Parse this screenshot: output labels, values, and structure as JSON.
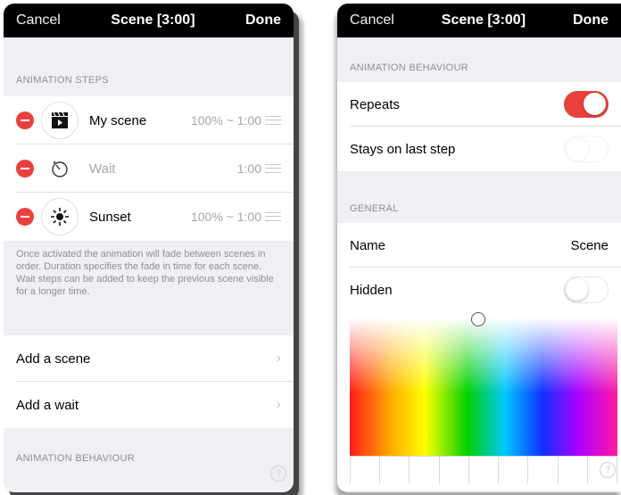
{
  "left": {
    "nav": {
      "cancel": "Cancel",
      "title": "Scene [3:00]",
      "done": "Done"
    },
    "steps_header": "ANIMATION STEPS",
    "steps": [
      {
        "icon": "scene-icon",
        "label": "My scene",
        "value": "100% ~ 1:00"
      },
      {
        "icon": "timer-icon",
        "label": "Wait",
        "value": "1:00"
      },
      {
        "icon": "sun-icon",
        "label": "Sunset",
        "value": "100% ~ 1:00"
      }
    ],
    "footer_note": "Once activated the animation will fade between scenes in order. Duration specifies the fade in time for each scene. Wait steps can be added to keep the previous scene visible for a longer time.",
    "actions": [
      {
        "label": "Add a scene"
      },
      {
        "label": "Add a wait"
      }
    ],
    "behaviour_header": "ANIMATION BEHAVIOUR"
  },
  "right": {
    "nav": {
      "cancel": "Cancel",
      "title": "Scene [3:00]",
      "done": "Done"
    },
    "behaviour_header": "ANIMATION BEHAVIOUR",
    "repeats_label": "Repeats",
    "repeats_on": true,
    "stays_label": "Stays on last step",
    "stays_on": false,
    "general_header": "GENERAL",
    "name_label": "Name",
    "name_value": "Scene",
    "hidden_label": "Hidden",
    "hidden_on": false
  },
  "colors": {
    "accent": "#e8413d",
    "nav_bg": "#000000",
    "group_bg": "#efeff4"
  }
}
